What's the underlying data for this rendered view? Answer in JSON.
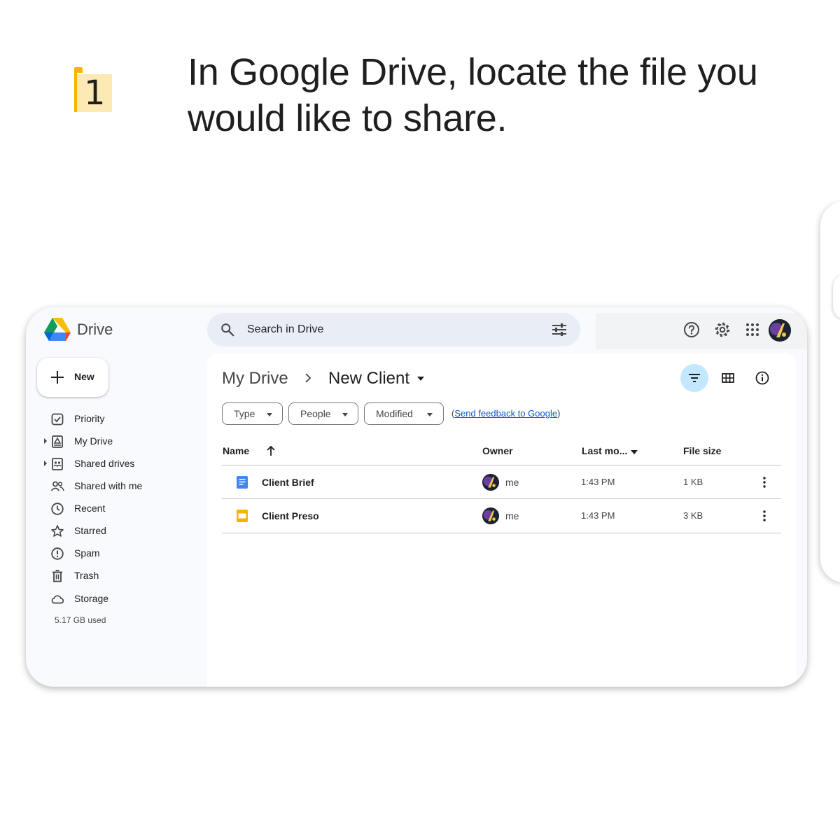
{
  "step": {
    "number": "1",
    "title": "In Google Drive, locate the file you would like to share."
  },
  "app": {
    "brand": "Drive",
    "search_placeholder": "Search in Drive"
  },
  "sidebar": {
    "new_label": "New",
    "items": [
      {
        "label": "Priority",
        "icon": "priority-icon",
        "expandable": false
      },
      {
        "label": "My Drive",
        "icon": "my-drive-icon",
        "expandable": true
      },
      {
        "label": "Shared drives",
        "icon": "shared-drives-icon",
        "expandable": true
      },
      {
        "label": "Shared with me",
        "icon": "shared-with-me-icon",
        "expandable": false
      },
      {
        "label": "Recent",
        "icon": "clock-icon",
        "expandable": false
      },
      {
        "label": "Starred",
        "icon": "star-icon",
        "expandable": false
      },
      {
        "label": "Spam",
        "icon": "spam-icon",
        "expandable": false
      },
      {
        "label": "Trash",
        "icon": "trash-icon",
        "expandable": false
      },
      {
        "label": "Storage",
        "icon": "cloud-icon",
        "expandable": false
      }
    ],
    "storage_used": "5.17 GB used"
  },
  "breadcrumb": {
    "root": "My Drive",
    "current": "New Client"
  },
  "filters": {
    "type": "Type",
    "people": "People",
    "modified": "Modified",
    "feedback_open": "(",
    "feedback_link": "Send feedback to Google",
    "feedback_close": ")"
  },
  "table": {
    "headers": {
      "name": "Name",
      "owner": "Owner",
      "modified": "Last mo...",
      "size": "File size"
    },
    "rows": [
      {
        "name": "Client Brief",
        "type": "docs",
        "owner": "me",
        "modified": "1:43 PM",
        "size": "1 KB"
      },
      {
        "name": "Client Preso",
        "type": "slides",
        "owner": "me",
        "modified": "1:43 PM",
        "size": "3 KB"
      }
    ]
  },
  "colors": {
    "docs": "#4285f4",
    "slides": "#f9b300",
    "filter_active": "#c2e7ff",
    "link": "#0b57d0"
  }
}
